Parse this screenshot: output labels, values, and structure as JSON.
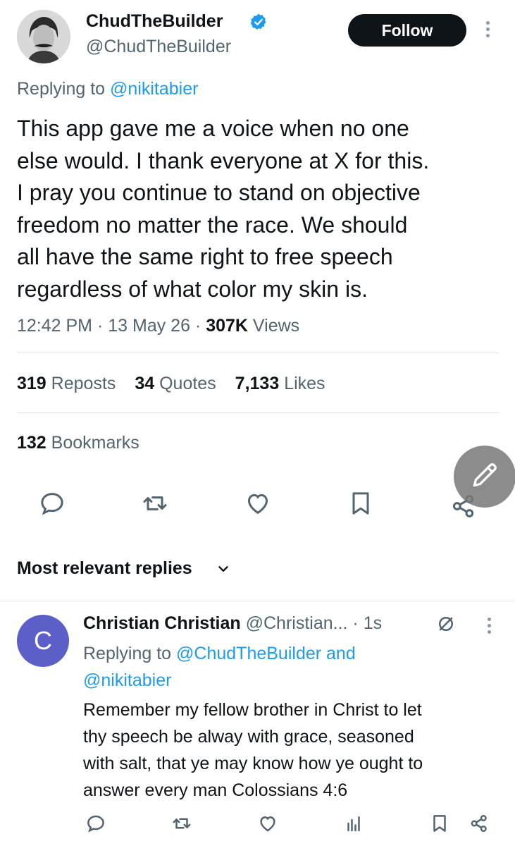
{
  "tweet": {
    "author": {
      "display_name": "ChudTheBuilder",
      "handle": "@ChudTheBuilder",
      "verified": true
    },
    "follow_label": "Follow",
    "replying_to_prefix": "Replying to ",
    "replying_to_handle": "@nikitabier",
    "text": "This app gave me a voice when no one\nelse would. I thank everyone at X for this.\nI pray you continue to stand on objective\nfreedom no matter the race. We should\nall have the same right to free speech\nregardless of what color my skin is.",
    "time": "12:42 PM",
    "date": "13 May 26",
    "views_count": "307K",
    "views_label": "Views",
    "stats": {
      "reposts_count": "319",
      "reposts_label": "Reposts",
      "quotes_count": "34",
      "quotes_label": "Quotes",
      "likes_count": "7,133",
      "likes_label": "Likes",
      "bookmarks_count": "132",
      "bookmarks_label": "Bookmarks"
    },
    "actions": [
      "reply-icon",
      "repost-icon",
      "like-icon",
      "bookmark-icon",
      "share-icon"
    ]
  },
  "fab": {
    "icon": "compose-icon"
  },
  "replies_filter": {
    "label": "Most relevant replies"
  },
  "reply": {
    "avatar_letter": "C",
    "avatar_color": "#5b5fc7",
    "display_name": "Christian Christian",
    "handle": "@Christian...",
    "sep": " · ",
    "time": "1s",
    "replying_to_prefix": "Replying to ",
    "replying_to_handle1": "@ChudTheBuilder",
    "replying_to_and": " and",
    "replying_to_handle2": "@nikitabier",
    "text": "Remember my fellow brother in Christ to let\nthy speech be alway with grace, seasoned\nwith salt, that ye may know how ye ought to\nanswer every man Colossians 4:6"
  },
  "colors": {
    "accent": "#1d9bf0",
    "text_primary": "#0f1419",
    "text_secondary": "#536471",
    "divider": "#e1e6ea"
  }
}
